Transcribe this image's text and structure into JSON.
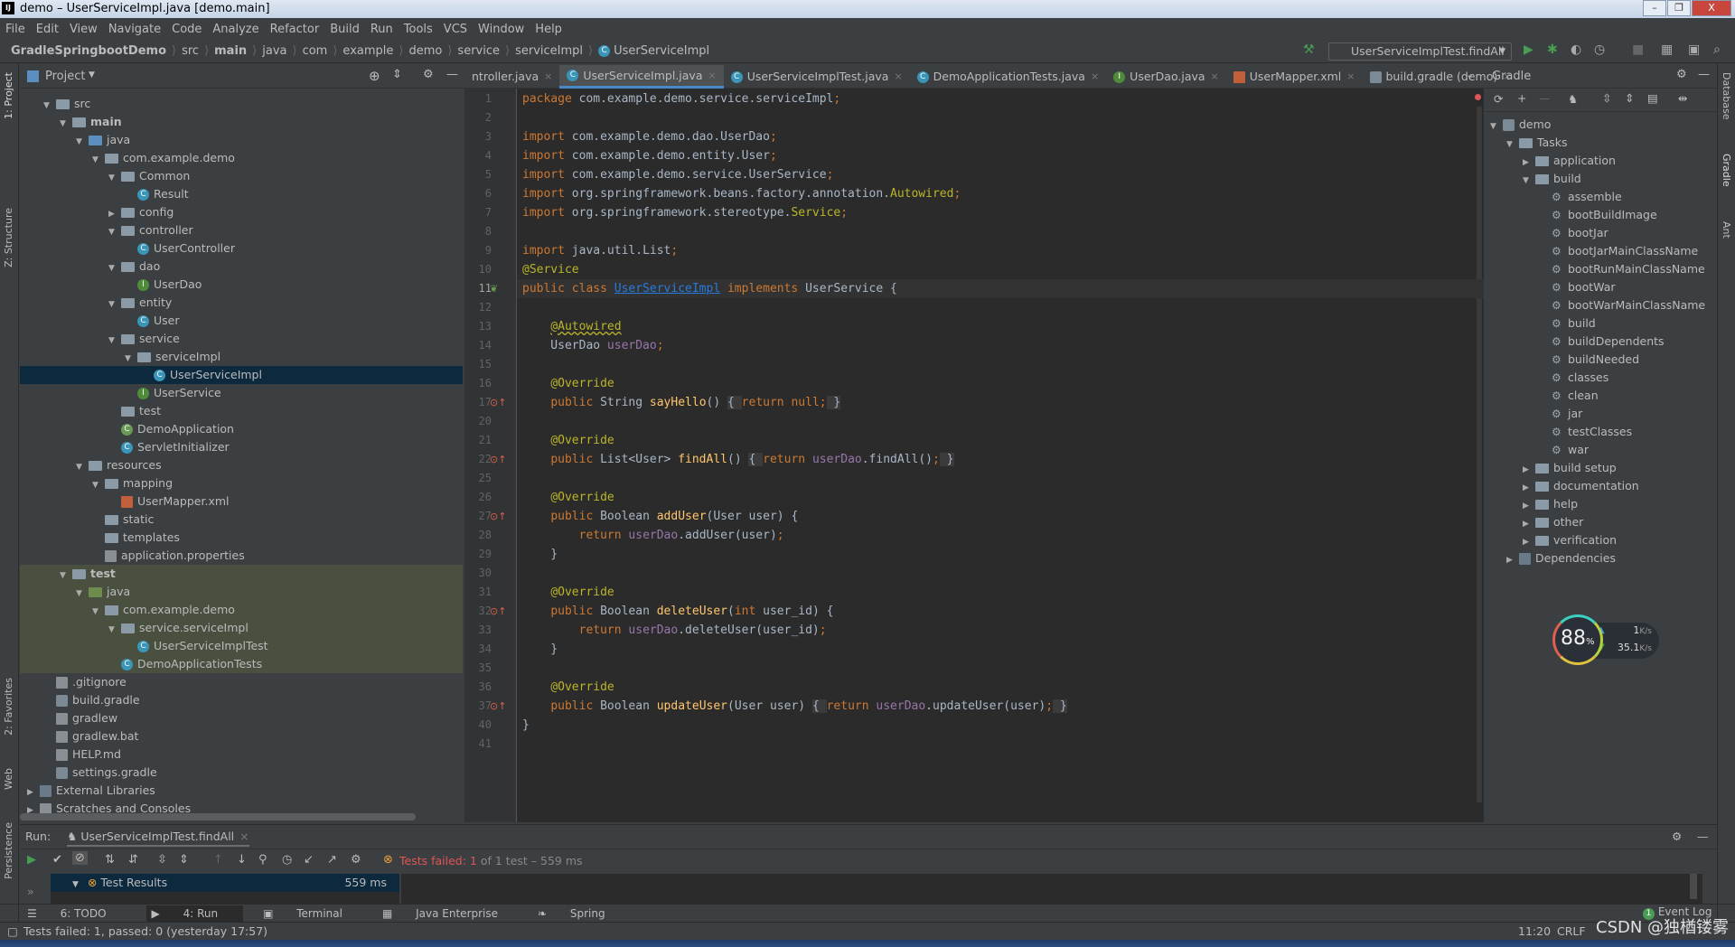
{
  "window": {
    "title": "demo – UserServiceImpl.java [demo.main]",
    "controls": [
      "–",
      "❐",
      "X"
    ]
  },
  "menu": [
    "File",
    "Edit",
    "View",
    "Navigate",
    "Code",
    "Analyze",
    "Refactor",
    "Build",
    "Run",
    "Tools",
    "VCS",
    "Window",
    "Help"
  ],
  "breadcrumb": [
    "GradleSpringbootDemo",
    "src",
    "main",
    "java",
    "com",
    "example",
    "demo",
    "service",
    "serviceImpl",
    "UserServiceImpl"
  ],
  "run_config": "UserServiceImplTest.findAll",
  "project_panel": {
    "title": "Project",
    "tree": [
      {
        "l": "src",
        "d": 1,
        "ic": "folder",
        "ar": "▼"
      },
      {
        "l": "main",
        "d": 2,
        "ic": "folder",
        "ar": "▼",
        "b": true
      },
      {
        "l": "java",
        "d": 3,
        "ic": "blue",
        "ar": "▼"
      },
      {
        "l": "com.example.demo",
        "d": 4,
        "ic": "folder",
        "ar": "▼"
      },
      {
        "l": "Common",
        "d": 5,
        "ic": "folder",
        "ar": "▼"
      },
      {
        "l": "Result",
        "d": 6,
        "ic": "c"
      },
      {
        "l": "config",
        "d": 5,
        "ic": "folder",
        "ar": "▶"
      },
      {
        "l": "controller",
        "d": 5,
        "ic": "folder",
        "ar": "▼"
      },
      {
        "l": "UserController",
        "d": 6,
        "ic": "c"
      },
      {
        "l": "dao",
        "d": 5,
        "ic": "folder",
        "ar": "▼"
      },
      {
        "l": "UserDao",
        "d": 6,
        "ic": "i"
      },
      {
        "l": "entity",
        "d": 5,
        "ic": "folder",
        "ar": "▼"
      },
      {
        "l": "User",
        "d": 6,
        "ic": "c"
      },
      {
        "l": "service",
        "d": 5,
        "ic": "folder",
        "ar": "▼"
      },
      {
        "l": "serviceImpl",
        "d": 6,
        "ic": "folder",
        "ar": "▼"
      },
      {
        "l": "UserServiceImpl",
        "d": 7,
        "ic": "c",
        "sel": true
      },
      {
        "l": "UserService",
        "d": 6,
        "ic": "i"
      },
      {
        "l": "test",
        "d": 5,
        "ic": "folder"
      },
      {
        "l": "DemoApplication",
        "d": 5,
        "ic": "sp"
      },
      {
        "l": "ServletInitializer",
        "d": 5,
        "ic": "c"
      },
      {
        "l": "resources",
        "d": 3,
        "ic": "folder",
        "ar": "▼"
      },
      {
        "l": "mapping",
        "d": 4,
        "ic": "folder",
        "ar": "▼"
      },
      {
        "l": "UserMapper.xml",
        "d": 5,
        "ic": "xml"
      },
      {
        "l": "static",
        "d": 4,
        "ic": "folder"
      },
      {
        "l": "templates",
        "d": 4,
        "ic": "folder"
      },
      {
        "l": "application.properties",
        "d": 4,
        "ic": "file"
      },
      {
        "l": "test",
        "d": 2,
        "ic": "folder",
        "ar": "▼",
        "b": true,
        "t": true
      },
      {
        "l": "java",
        "d": 3,
        "ic": "green",
        "ar": "▼",
        "t": true
      },
      {
        "l": "com.example.demo",
        "d": 4,
        "ic": "folder",
        "ar": "▼",
        "t": true
      },
      {
        "l": "service.serviceImpl",
        "d": 5,
        "ic": "folder",
        "ar": "▼",
        "t": true
      },
      {
        "l": "UserServiceImplTest",
        "d": 6,
        "ic": "c",
        "t": true
      },
      {
        "l": "DemoApplicationTests",
        "d": 5,
        "ic": "c",
        "t": true
      },
      {
        "l": ".gitignore",
        "d": 1,
        "ic": "file"
      },
      {
        "l": "build.gradle",
        "d": 1,
        "ic": "gr"
      },
      {
        "l": "gradlew",
        "d": 1,
        "ic": "file"
      },
      {
        "l": "gradlew.bat",
        "d": 1,
        "ic": "file"
      },
      {
        "l": "HELP.md",
        "d": 1,
        "ic": "file"
      },
      {
        "l": "settings.gradle",
        "d": 1,
        "ic": "gr"
      },
      {
        "l": "External Libraries",
        "d": 0,
        "ic": "lib",
        "ar": "▶"
      },
      {
        "l": "Scratches and Consoles",
        "d": 0,
        "ic": "file",
        "ar": "▶"
      }
    ]
  },
  "tabs": [
    {
      "label": "ntroller.java"
    },
    {
      "label": "UserServiceImpl.java",
      "active": true
    },
    {
      "label": "UserServiceImplTest.java"
    },
    {
      "label": "DemoApplicationTests.java"
    },
    {
      "label": "UserDao.java"
    },
    {
      "label": "UserMapper.xml"
    },
    {
      "label": "build.gradle (demo)"
    }
  ],
  "editor": {
    "current_line": 11,
    "lines": [
      {
        "n": 1,
        "t": [
          [
            "package ",
            "k"
          ],
          [
            "com.example.demo.service.serviceImpl",
            ""
          ],
          [
            ";",
            "k"
          ]
        ]
      },
      {
        "n": 2,
        "t": []
      },
      {
        "n": 3,
        "t": [
          [
            "import ",
            "k"
          ],
          [
            "com.example.demo.dao.UserDao",
            ""
          ],
          [
            ";",
            "k"
          ]
        ]
      },
      {
        "n": 4,
        "t": [
          [
            "import ",
            "k"
          ],
          [
            "com.example.demo.entity.User",
            ""
          ],
          [
            ";",
            "k"
          ]
        ]
      },
      {
        "n": 5,
        "t": [
          [
            "import ",
            "k"
          ],
          [
            "com.example.demo.service.UserService",
            ""
          ],
          [
            ";",
            "k"
          ]
        ]
      },
      {
        "n": 6,
        "t": [
          [
            "import ",
            "k"
          ],
          [
            "org.springframework.beans.factory.annotation.",
            ""
          ],
          [
            "Autowired",
            "a"
          ],
          [
            ";",
            "k"
          ]
        ]
      },
      {
        "n": 7,
        "t": [
          [
            "import ",
            "k"
          ],
          [
            "org.springframework.stereotype.",
            ""
          ],
          [
            "Service",
            "a"
          ],
          [
            ";",
            "k"
          ]
        ]
      },
      {
        "n": 8,
        "t": []
      },
      {
        "n": 9,
        "t": [
          [
            "import ",
            "k"
          ],
          [
            "java.util.List",
            ""
          ],
          [
            ";",
            "k"
          ]
        ]
      },
      {
        "n": 10,
        "t": [
          [
            "@Service",
            "a"
          ]
        ]
      },
      {
        "n": 11,
        "t": [
          [
            "public class ",
            "k"
          ],
          [
            "UserServiceImpl",
            "cl"
          ],
          [
            " implements ",
            "k"
          ],
          [
            "UserService {",
            ""
          ]
        ],
        "g": "bean"
      },
      {
        "n": 12,
        "t": []
      },
      {
        "n": 13,
        "t": [
          [
            "    ",
            ""
          ],
          [
            "@Autowired",
            "au"
          ]
        ]
      },
      {
        "n": 14,
        "t": [
          [
            "    UserDao ",
            ""
          ],
          [
            "userDao",
            "f"
          ],
          [
            ";",
            "k"
          ]
        ]
      },
      {
        "n": 15,
        "t": []
      },
      {
        "n": 16,
        "t": [
          [
            "    ",
            ""
          ],
          [
            "@Override",
            "a"
          ]
        ]
      },
      {
        "n": 17,
        "t": [
          [
            "    ",
            ""
          ],
          [
            "public ",
            "k"
          ],
          [
            "String ",
            ""
          ],
          [
            "sayHello",
            "m"
          ],
          [
            "() ",
            ""
          ],
          [
            "{ ",
            "fold-in"
          ],
          [
            "return null;",
            "k"
          ],
          [
            " }",
            "fold-in"
          ]
        ],
        "g": "override"
      },
      {
        "n": 20,
        "t": []
      },
      {
        "n": 21,
        "t": [
          [
            "    ",
            ""
          ],
          [
            "@Override",
            "a"
          ]
        ]
      },
      {
        "n": 22,
        "t": [
          [
            "    ",
            ""
          ],
          [
            "public ",
            "k"
          ],
          [
            "List<User> ",
            ""
          ],
          [
            "findAll",
            "m"
          ],
          [
            "() ",
            ""
          ],
          [
            "{ ",
            "fold-in"
          ],
          [
            "return ",
            "k"
          ],
          [
            "userDao",
            "f"
          ],
          [
            ".findAll()",
            ""
          ],
          [
            ";",
            "k"
          ],
          [
            " }",
            "fold-in"
          ]
        ],
        "g": "override"
      },
      {
        "n": 25,
        "t": []
      },
      {
        "n": 26,
        "t": [
          [
            "    ",
            ""
          ],
          [
            "@Override",
            "a"
          ]
        ]
      },
      {
        "n": 27,
        "t": [
          [
            "    ",
            ""
          ],
          [
            "public ",
            "k"
          ],
          [
            "Boolean ",
            ""
          ],
          [
            "addUser",
            "m"
          ],
          [
            "(User user) {",
            ""
          ]
        ],
        "g": "override"
      },
      {
        "n": 28,
        "t": [
          [
            "        ",
            ""
          ],
          [
            "return ",
            "k"
          ],
          [
            "userDao",
            "f"
          ],
          [
            ".addUser(user)",
            ""
          ],
          [
            ";",
            "k"
          ]
        ]
      },
      {
        "n": 29,
        "t": [
          [
            "    }",
            ""
          ]
        ]
      },
      {
        "n": 30,
        "t": []
      },
      {
        "n": 31,
        "t": [
          [
            "    ",
            ""
          ],
          [
            "@Override",
            "a"
          ]
        ]
      },
      {
        "n": 32,
        "t": [
          [
            "    ",
            ""
          ],
          [
            "public ",
            "k"
          ],
          [
            "Boolean ",
            ""
          ],
          [
            "deleteUser",
            "m"
          ],
          [
            "(",
            ""
          ],
          [
            "int ",
            "k"
          ],
          [
            "user_id) {",
            ""
          ]
        ],
        "g": "override"
      },
      {
        "n": 33,
        "t": [
          [
            "        ",
            ""
          ],
          [
            "return ",
            "k"
          ],
          [
            "userDao",
            "f"
          ],
          [
            ".deleteUser(user_id)",
            ""
          ],
          [
            ";",
            "k"
          ]
        ]
      },
      {
        "n": 34,
        "t": [
          [
            "    }",
            ""
          ]
        ]
      },
      {
        "n": 35,
        "t": []
      },
      {
        "n": 36,
        "t": [
          [
            "    ",
            ""
          ],
          [
            "@Override",
            "a"
          ]
        ]
      },
      {
        "n": 37,
        "t": [
          [
            "    ",
            ""
          ],
          [
            "public ",
            "k"
          ],
          [
            "Boolean ",
            ""
          ],
          [
            "updateUser",
            "m"
          ],
          [
            "(User user) ",
            ""
          ],
          [
            "{ ",
            "fold-in"
          ],
          [
            "return ",
            "k"
          ],
          [
            "userDao",
            "f"
          ],
          [
            ".updateUser(user)",
            ""
          ],
          [
            ";",
            "k"
          ],
          [
            " }",
            "fold-in"
          ]
        ],
        "g": "override"
      },
      {
        "n": 40,
        "t": [
          [
            "}",
            ""
          ]
        ]
      },
      {
        "n": 41,
        "t": []
      }
    ]
  },
  "gradle_panel": {
    "title": "Gradle",
    "tree": [
      {
        "l": "demo",
        "d": 0,
        "ar": "▼",
        "ic": "gr"
      },
      {
        "l": "Tasks",
        "d": 1,
        "ar": "▼",
        "ic": "folder"
      },
      {
        "l": "application",
        "d": 2,
        "ar": "▶",
        "ic": "folder"
      },
      {
        "l": "build",
        "d": 2,
        "ar": "▼",
        "ic": "folder"
      },
      {
        "l": "assemble",
        "d": 3,
        "ic": "gear"
      },
      {
        "l": "bootBuildImage",
        "d": 3,
        "ic": "gear"
      },
      {
        "l": "bootJar",
        "d": 3,
        "ic": "gear"
      },
      {
        "l": "bootJarMainClassName",
        "d": 3,
        "ic": "gear"
      },
      {
        "l": "bootRunMainClassName",
        "d": 3,
        "ic": "gear"
      },
      {
        "l": "bootWar",
        "d": 3,
        "ic": "gear"
      },
      {
        "l": "bootWarMainClassName",
        "d": 3,
        "ic": "gear"
      },
      {
        "l": "build",
        "d": 3,
        "ic": "gear"
      },
      {
        "l": "buildDependents",
        "d": 3,
        "ic": "gear"
      },
      {
        "l": "buildNeeded",
        "d": 3,
        "ic": "gear"
      },
      {
        "l": "classes",
        "d": 3,
        "ic": "gear"
      },
      {
        "l": "clean",
        "d": 3,
        "ic": "gear"
      },
      {
        "l": "jar",
        "d": 3,
        "ic": "gear"
      },
      {
        "l": "testClasses",
        "d": 3,
        "ic": "gear"
      },
      {
        "l": "war",
        "d": 3,
        "ic": "gear"
      },
      {
        "l": "build setup",
        "d": 2,
        "ar": "▶",
        "ic": "folder"
      },
      {
        "l": "documentation",
        "d": 2,
        "ar": "▶",
        "ic": "folder"
      },
      {
        "l": "help",
        "d": 2,
        "ar": "▶",
        "ic": "folder"
      },
      {
        "l": "other",
        "d": 2,
        "ar": "▶",
        "ic": "folder"
      },
      {
        "l": "verification",
        "d": 2,
        "ar": "▶",
        "ic": "folder"
      },
      {
        "l": "Dependencies",
        "d": 1,
        "ar": "▶",
        "ic": "lib"
      }
    ]
  },
  "side_stripes": {
    "left": [
      "1: Project",
      "Z: Structure",
      "2: Favorites",
      "Web",
      "Persistence"
    ],
    "right": [
      "Database",
      "Gradle",
      "Ant"
    ]
  },
  "net_widget": {
    "percent": "88",
    "pct_sign": "%",
    "up": "1",
    "down": "35.1",
    "unit": "K/s"
  },
  "run_panel": {
    "label": "Run:",
    "tab": "UserServiceImplTest.findAll",
    "status_prefix": "Tests failed: ",
    "failed": "1",
    "status_suffix": " of 1 test – 559 ms",
    "results_label": "Test Results",
    "results_time": "559 ms"
  },
  "tool_windows": [
    "6: TODO",
    "4: Run",
    "Terminal",
    "Java Enterprise",
    "Spring"
  ],
  "event_log": {
    "count": "1",
    "label": "Event Log"
  },
  "status_bar": {
    "message": "Tests failed: 1, passed: 0 (yesterday 17:57)",
    "position": "11:20",
    "line_sep": "CRLF"
  },
  "watermark": "CSDN @独楢镂雾",
  "colors": {
    "accent": "#4a88c7",
    "keyword": "#cc7832",
    "annotation": "#bbb529",
    "method": "#ffc66d",
    "field": "#9876aa",
    "error": "#e05555"
  }
}
